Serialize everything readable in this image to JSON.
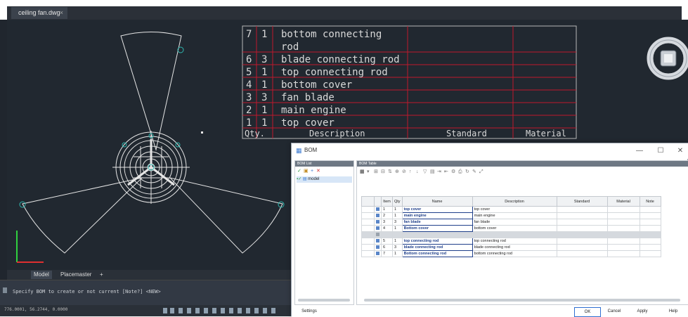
{
  "window": {
    "doc_tab": "ceiling fan.dwg",
    "doc_tab_close": "×"
  },
  "drawing_table": {
    "rows": [
      {
        "num": "7",
        "qty": "1",
        "desc": "bottom connecting"
      },
      {
        "num": "",
        "qty": "",
        "desc": "rod"
      },
      {
        "num": "6",
        "qty": "3",
        "desc": "blade connecting rod"
      },
      {
        "num": "5",
        "qty": "1",
        "desc": "top connecting rod"
      },
      {
        "num": "4",
        "qty": "1",
        "desc": "bottom cover"
      },
      {
        "num": "3",
        "qty": "3",
        "desc": "fan blade"
      },
      {
        "num": "2",
        "qty": "1",
        "desc": "main engine"
      },
      {
        "num": "1",
        "qty": "1",
        "desc": "top cover"
      }
    ],
    "header": {
      "qty": "Qty.",
      "description": "Description",
      "standard": "Standard",
      "material": "Material"
    },
    "text_color": "#d9d9d9",
    "grid_color": "#c0182c"
  },
  "layout_tabs": {
    "model": "Model",
    "layout": "Placemaster",
    "add": "+"
  },
  "command_line": {
    "text": "Specify BOM to create or not current [Note?] <NEW>"
  },
  "status_bar": {
    "coords": "776.0001, 56.2744, 0.0000"
  },
  "bom_dialog": {
    "title": "BOM",
    "minimize": "—",
    "maximize": "☐",
    "close": "✕",
    "left_pane": {
      "header": "BOM List",
      "tree_root": "model"
    },
    "right_pane": {
      "header": "BOM Table"
    },
    "table": {
      "columns": [
        "",
        "",
        "Item",
        "Qty",
        "Name",
        "Description",
        "Standard",
        "Material",
        "Note"
      ],
      "rows": [
        {
          "item": "1",
          "qty": "1",
          "name": "top cover",
          "description": "top cover",
          "separator": false
        },
        {
          "item": "2",
          "qty": "1",
          "name": "main engine",
          "description": "main engine",
          "separator": false
        },
        {
          "item": "3",
          "qty": "3",
          "name": "fan blade",
          "description": "fan blade",
          "separator": false
        },
        {
          "item": "4",
          "qty": "1",
          "name": "Bottom cover",
          "description": "bottom cover",
          "separator": false
        },
        {
          "item": "",
          "qty": "",
          "name": "",
          "description": "",
          "separator": true
        },
        {
          "item": "5",
          "qty": "1",
          "name": "top connecting rod",
          "description": "top connecting rod",
          "separator": false
        },
        {
          "item": "6",
          "qty": "3",
          "name": "blade connecting rod",
          "description": "blade connecting rod",
          "separator": false
        },
        {
          "item": "7",
          "qty": "1",
          "name": "Bottom connecting rod",
          "description": "bottom connecting rod",
          "separator": false
        }
      ]
    },
    "footer": {
      "settings": "Settings",
      "ok": "OK",
      "cancel": "Cancel",
      "apply": "Apply",
      "help": "Help"
    }
  },
  "colors": {
    "cad_background": "#212830",
    "drawing_lines": "#e6e6e6",
    "cyan_markers": "#2fb8b0",
    "ucs_x": "#e03030",
    "ucs_y": "#30d040",
    "dialog_accent": "#2f6fd1"
  }
}
